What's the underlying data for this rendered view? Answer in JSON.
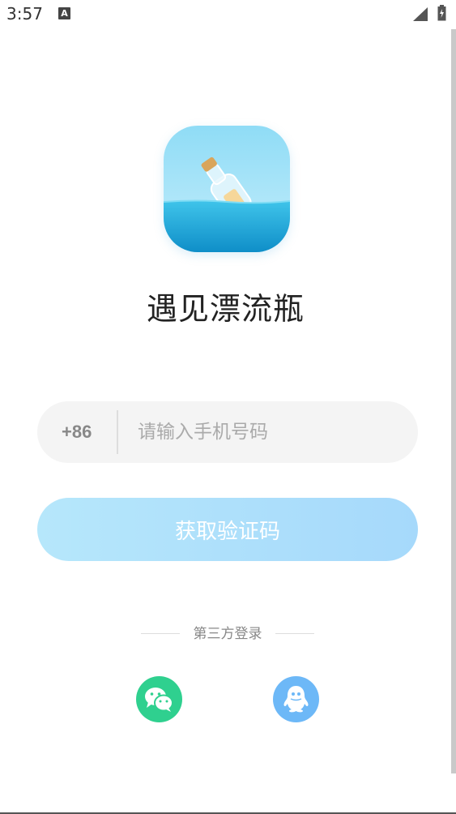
{
  "status_bar": {
    "time": "3:57",
    "notification_icon": "a-icon",
    "signal_icon": "signal-icon",
    "battery_icon": "battery-charging-icon"
  },
  "app": {
    "logo_icon": "message-bottle-icon",
    "title": "遇见漂流瓶"
  },
  "login": {
    "country_code": "+86",
    "phone_placeholder": "请输入手机号码",
    "phone_value": "",
    "get_code_label": "获取验证码"
  },
  "third_party": {
    "label": "第三方登录",
    "wechat_icon": "wechat-icon",
    "qq_icon": "qq-icon"
  },
  "colors": {
    "button_gradient_start": "#b6e7fb",
    "button_gradient_end": "#a6d9fb",
    "wechat": "#2fd08f",
    "qq": "#6db8f7",
    "input_bg": "#f4f4f4"
  }
}
